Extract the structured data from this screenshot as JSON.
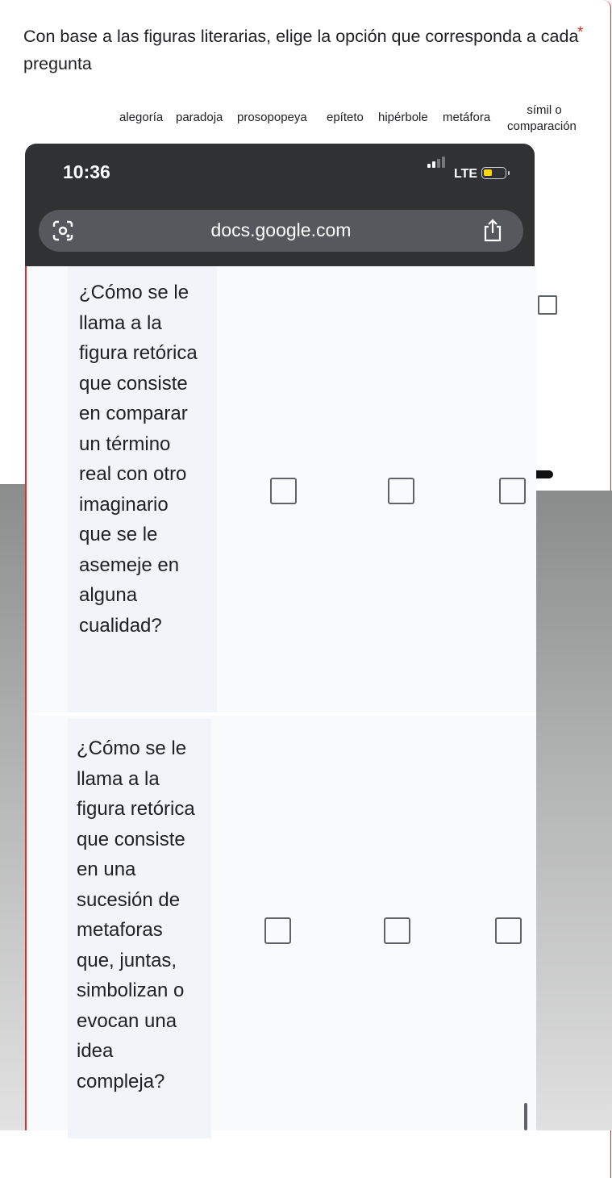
{
  "question": {
    "title": "Con base a las figuras literarias, elige la opción que corresponda a cada pregunta",
    "required_mark": "*"
  },
  "columns": [
    "alegoría",
    "paradoja",
    "prosopopeya",
    "epíteto",
    "hipérbole",
    "metáfora"
  ],
  "last_column": {
    "line1": "símil o",
    "line2": "comparación"
  },
  "status_bar": {
    "time": "10:36",
    "network": "LTE"
  },
  "browser": {
    "url": "docs.google.com"
  },
  "rows": [
    {
      "label": "¿Cómo se le llama a la figura retórica que consiste en comparar un término real con otro imaginario que se le asemeje en alguna cualidad?"
    },
    {
      "label": "¿Cómo se le llama a la figura retórica que consiste en una sucesión de metaforas que, juntas, simbolizan o evocan una idea compleja?"
    }
  ],
  "colors": {
    "accent_required": "#d93025",
    "status_bar": "#2f3133",
    "url_bar": "#55585c",
    "battery": "#ffd60a"
  },
  "icons": [
    "google-lens-icon",
    "share-icon",
    "signal-icon",
    "battery-icon",
    "checkbox-icon"
  ]
}
